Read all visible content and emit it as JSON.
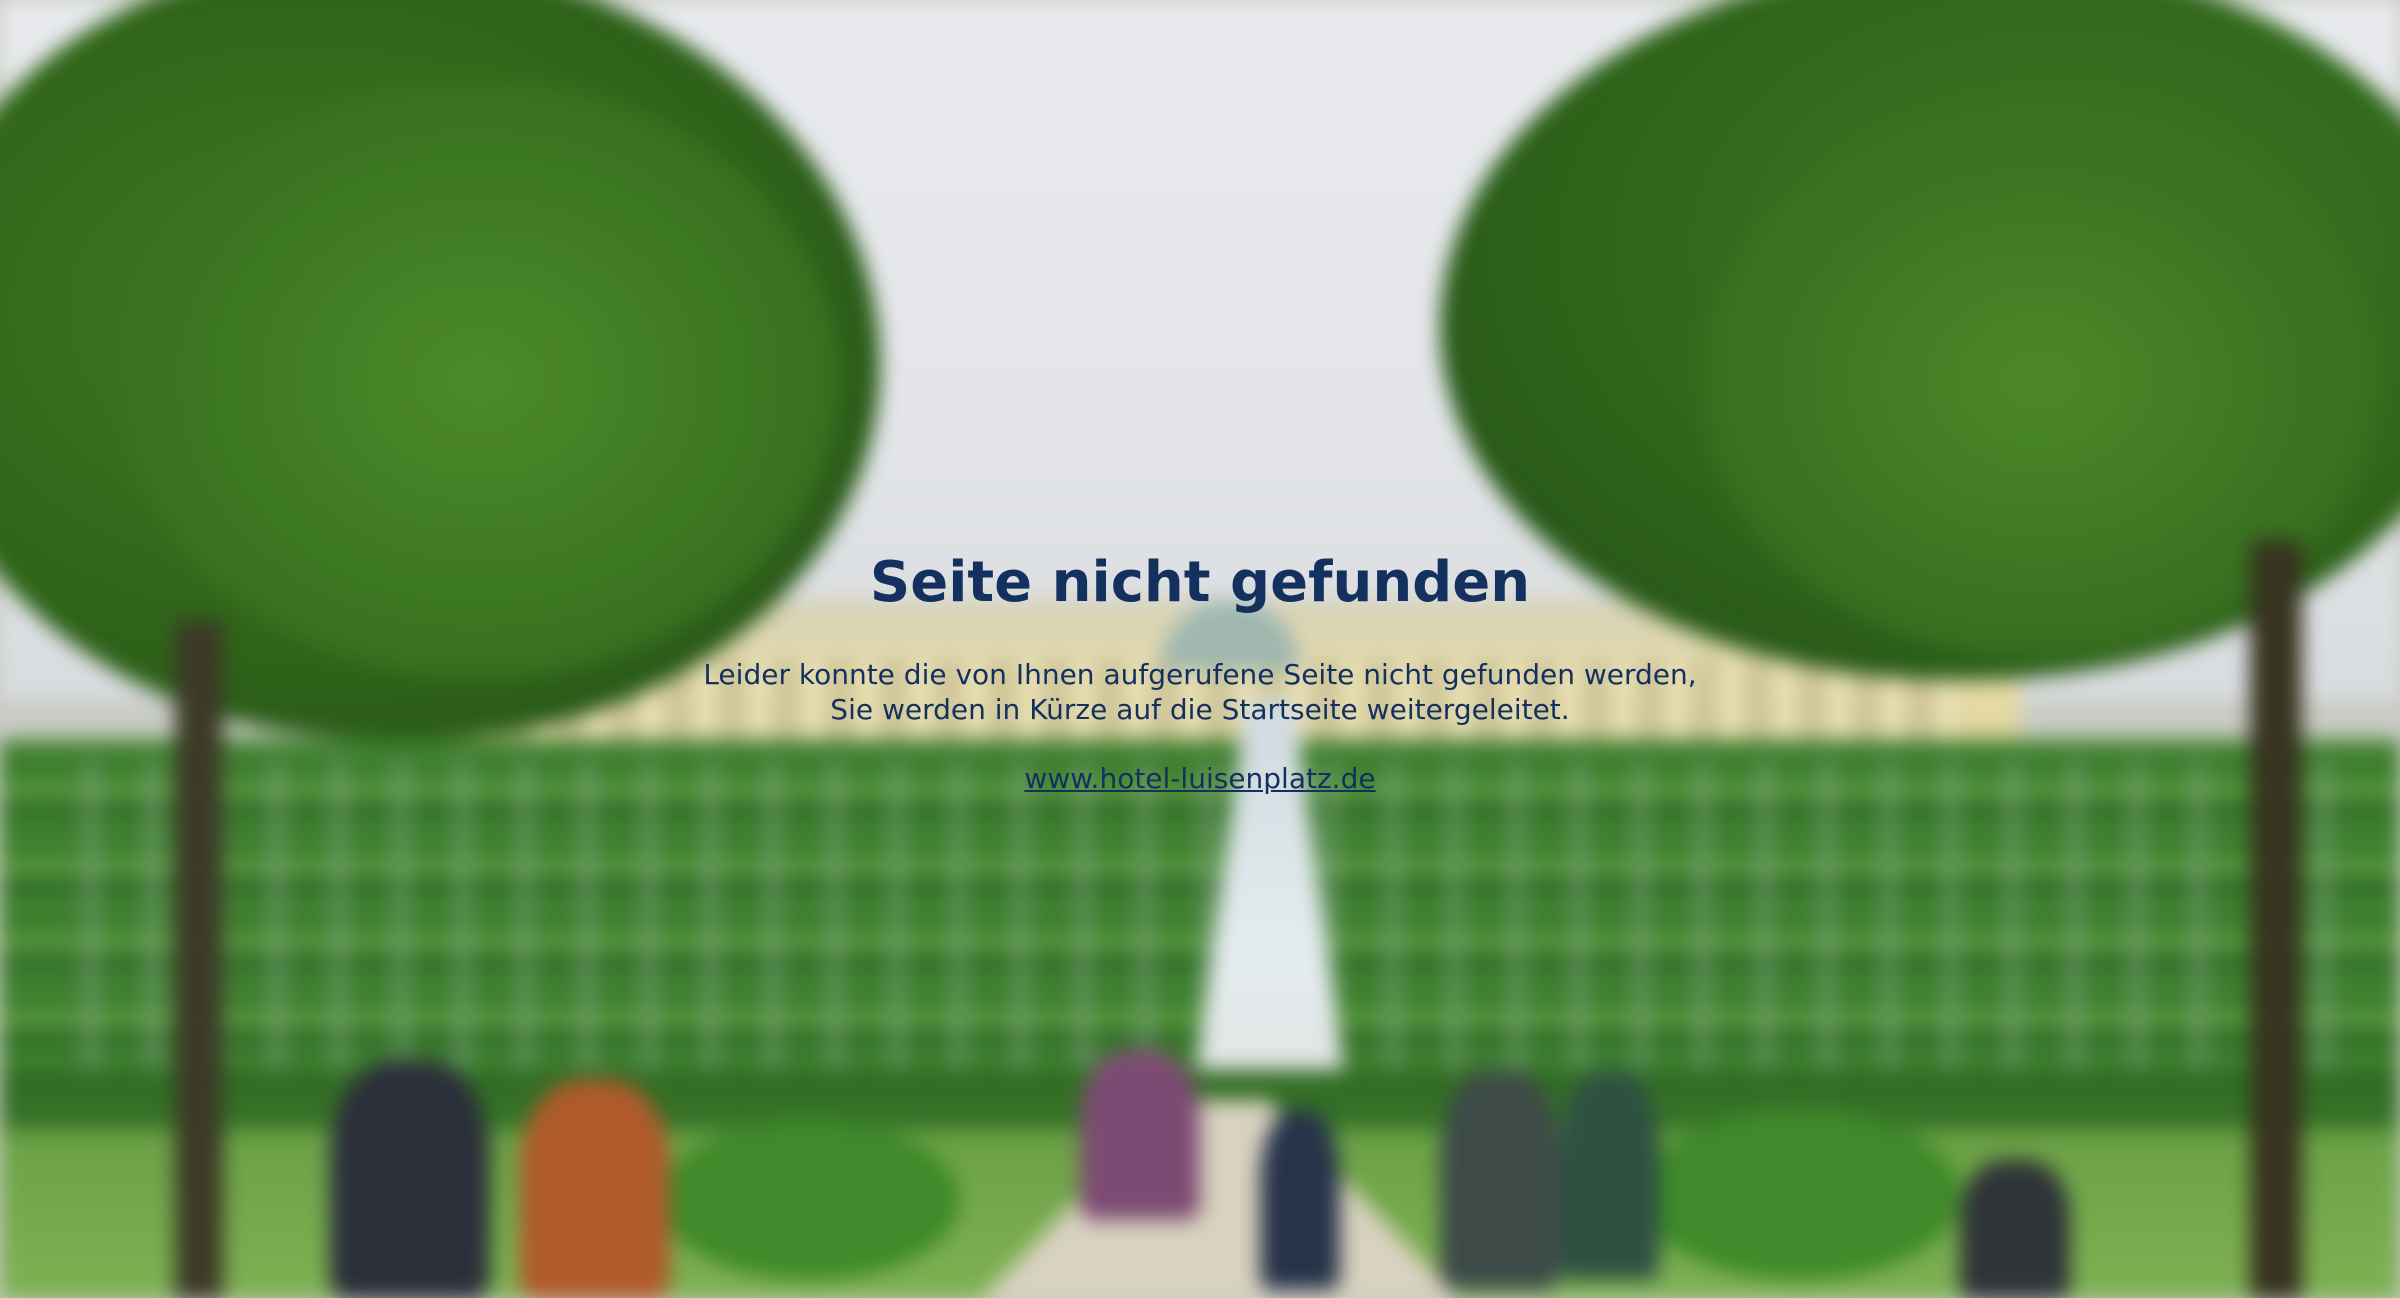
{
  "page": {
    "title": "Seite nicht gefunden",
    "message_line1": "Leider konnte die von Ihnen aufgerufene Seite nicht gefunden werden,",
    "message_line2": "Sie werden in Kürze auf die Startseite weitergeleitet.",
    "link_text": "www.hotel-luisenplatz.de"
  },
  "colors": {
    "text": "#14305f"
  }
}
